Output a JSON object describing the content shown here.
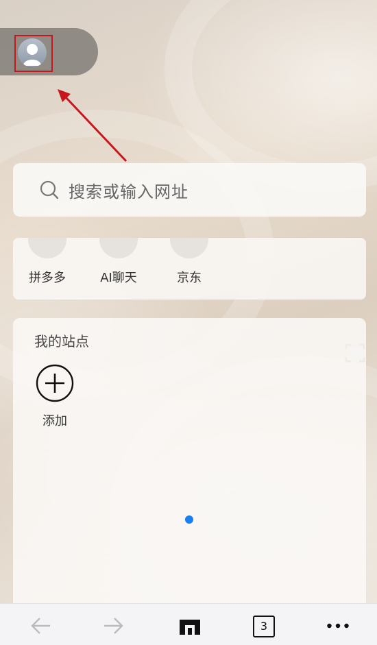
{
  "search": {
    "placeholder": "搜索或输入网址"
  },
  "quick_links": [
    {
      "label": "拼多多"
    },
    {
      "label": "AI聊天"
    },
    {
      "label": "京东"
    }
  ],
  "sites": {
    "title": "我的站点",
    "add_label": "添加"
  },
  "bottom_bar": {
    "tab_count": "3"
  },
  "icons": {
    "avatar": "user-avatar-icon",
    "search": "search-icon",
    "scan": "scan-icon",
    "add": "plus-circle-icon",
    "back": "arrow-left-icon",
    "forward": "arrow-right-icon",
    "home": "home-icon",
    "more": "more-dots-icon"
  },
  "colors": {
    "annotation": "#c8161d",
    "page_indicator": "#1a7ff0"
  }
}
